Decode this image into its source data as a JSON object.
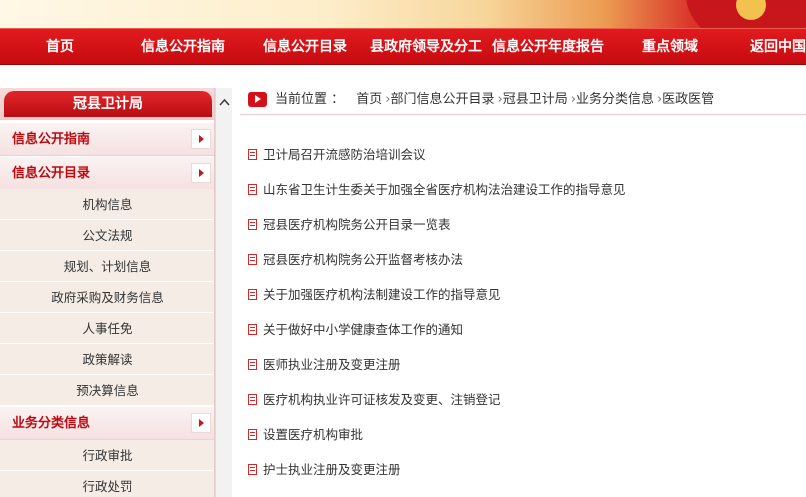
{
  "nav": {
    "items": [
      "首页",
      "信息公开指南",
      "信息公开目录",
      "县政府领导及分工",
      "信息公开年度报告",
      "重点领域",
      "返回中国"
    ]
  },
  "sidebar": {
    "title": "冠县卫计局",
    "categories": [
      "信息公开指南",
      "信息公开目录",
      "业务分类信息"
    ],
    "catalog_items": [
      "机构信息",
      "公文法规",
      "规划、计划信息",
      "政府采购及财务信息",
      "人事任免",
      "政策解读",
      "预决算信息"
    ],
    "business_items": [
      "行政审批",
      "行政处罚"
    ]
  },
  "breadcrumb": {
    "label": "当前位置 ：",
    "trail": [
      "首页",
      "部门信息公开目录",
      "冠县卫计局",
      "业务分类信息",
      "医政医管"
    ]
  },
  "articles": [
    "卫计局召开流感防治培训会议",
    "山东省卫生计生委关于加强全省医疗机构法治建设工作的指导意见",
    "冠县医疗机构院务公开目录一览表",
    "冠县医疗机构院务公开监督考核办法",
    "关于加强医疗机构法制建设工作的指导意见",
    "关于做好中小学健康查体工作的通知",
    "医师执业注册及变更注册",
    "医疗机构执业许可证核发及变更、注销登记",
    "设置医疗机构审批",
    "护士执业注册及变更注册"
  ],
  "colors": {
    "primary_red": "#c8141b",
    "category_text": "#bd0a10",
    "sub_item_bg": "#f4ece5"
  }
}
